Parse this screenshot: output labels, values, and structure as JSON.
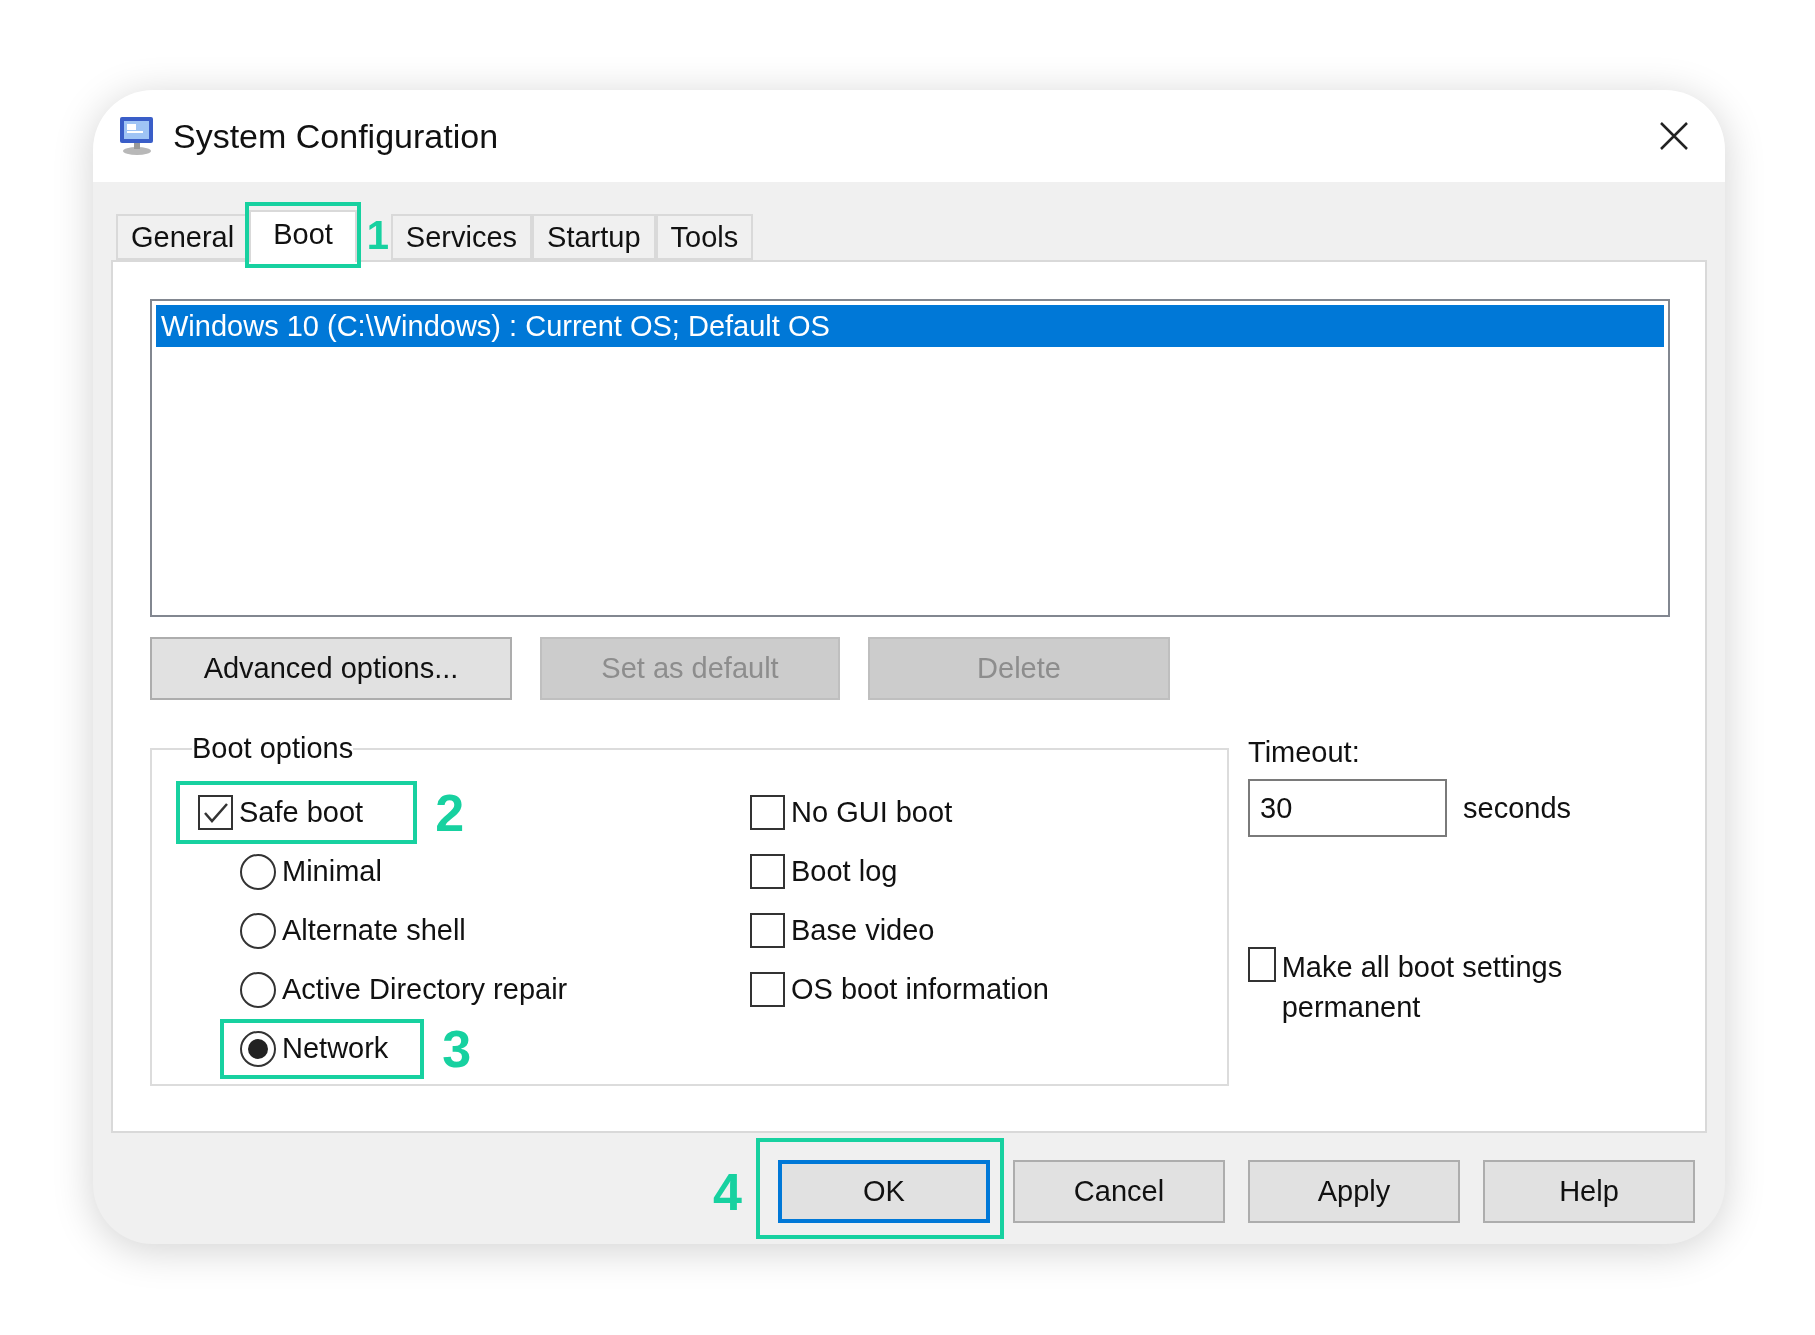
{
  "window": {
    "title": "System Configuration"
  },
  "tabs": [
    {
      "label": "General",
      "selected": false
    },
    {
      "label": "Boot",
      "selected": true,
      "callout": {
        "number": "1",
        "number_before": false
      }
    },
    {
      "label": "Services",
      "selected": false
    },
    {
      "label": "Startup",
      "selected": false
    },
    {
      "label": "Tools",
      "selected": false
    }
  ],
  "os_list": [
    {
      "label": "Windows 10 (C:\\Windows) : Current OS; Default OS",
      "selected": true
    }
  ],
  "list_buttons": [
    {
      "label": "Advanced options...",
      "disabled": false
    },
    {
      "label": "Set as default",
      "disabled": true
    },
    {
      "label": "Delete",
      "disabled": true
    }
  ],
  "boot_options": {
    "legend": "Boot options",
    "safe_boot": {
      "label": "Safe boot",
      "checked": true,
      "callout": {
        "number": "2",
        "number_before": false
      }
    },
    "safe_boot_modes": [
      {
        "label": "Minimal",
        "selected": false
      },
      {
        "label": "Alternate shell",
        "selected": false
      },
      {
        "label": "Active Directory repair",
        "selected": false
      },
      {
        "label": "Network",
        "selected": true,
        "callout": {
          "number": "3",
          "number_before": false
        }
      }
    ],
    "flags": [
      {
        "label": "No GUI boot",
        "checked": false
      },
      {
        "label": "Boot log",
        "checked": false
      },
      {
        "label": "Base video",
        "checked": false
      },
      {
        "label": "OS boot information",
        "checked": false
      }
    ]
  },
  "timeout": {
    "label": "Timeout:",
    "value": "30",
    "unit": "seconds"
  },
  "permanent": {
    "label": "Make all boot settings permanent",
    "checked": false
  },
  "dialog_buttons": [
    {
      "label": "OK",
      "default": true,
      "callout": {
        "number": "4",
        "number_before": true
      }
    },
    {
      "label": "Cancel",
      "default": false
    },
    {
      "label": "Apply",
      "default": false
    },
    {
      "label": "Help",
      "default": false
    }
  ]
}
